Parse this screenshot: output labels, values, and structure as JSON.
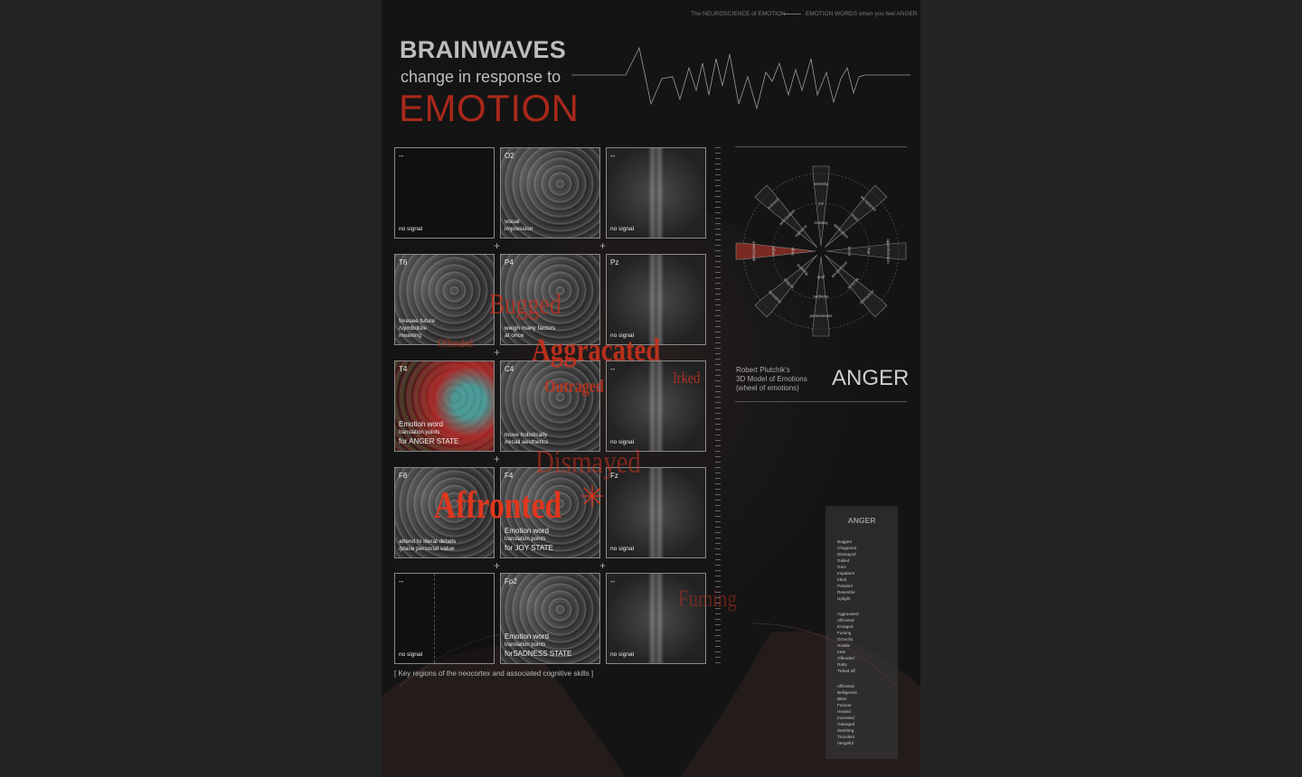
{
  "header": {
    "left": "The NEUROSCIENCE of EMOTION",
    "right": "EMOTION WORDS when you feel ANGER"
  },
  "title": {
    "line1": "BRAINWAVES",
    "line2": "change in response to",
    "line3": "EMOTION"
  },
  "grid": {
    "cells": [
      {
        "code": "--",
        "label": "no signal"
      },
      {
        "code": "O2",
        "label": "visual\nimpression"
      },
      {
        "code": "--",
        "label": "no signal"
      },
      {
        "code": "T6",
        "label": "foresee future\n/symbolize\nmeaning"
      },
      {
        "code": "P4",
        "label": "weigh many factors\nat once"
      },
      {
        "code": "Pz",
        "label": "no signal"
      },
      {
        "code": "T4",
        "label": "Emotion word",
        "sub": "translation points",
        "state": "for ANGER STATE"
      },
      {
        "code": "C4",
        "label": "move holistically\n/recall aesthetics"
      },
      {
        "code": "--",
        "label": "no signal"
      },
      {
        "code": "F8",
        "label": "attend to literal details\n/place personal value"
      },
      {
        "code": "F4",
        "label": "Emotion word",
        "sub": "translation points",
        "state": "for JOY STATE"
      },
      {
        "code": "Fz",
        "label": "no signal"
      },
      {
        "code": "--",
        "label": "no signal"
      },
      {
        "code": "Fp2",
        "label": "Emotion word",
        "sub": "translation points",
        "state": "forSADNESS STATE"
      },
      {
        "code": "--",
        "label": "no signal"
      }
    ],
    "caption": "[ Key regions of the neocortex and associated cognitive skills ]"
  },
  "overlay_words": [
    {
      "text": "Bugged"
    },
    {
      "text": "Offended"
    },
    {
      "text": "Aggracated"
    },
    {
      "text": "Outraged"
    },
    {
      "text": "Irked"
    },
    {
      "text": "Dismayed"
    },
    {
      "text": "Affronted"
    },
    {
      "text": "Fuming"
    }
  ],
  "wheel": {
    "highlight_color": "#7a2a22",
    "petals": [
      {
        "outer": "serenity",
        "mid": "joy",
        "inner": "ecstasy"
      },
      {
        "outer": "acceptance",
        "mid": "trust",
        "inner": "admiration"
      },
      {
        "outer": "apprehension",
        "mid": "fear",
        "inner": "terror"
      },
      {
        "outer": "distraction",
        "mid": "surprise",
        "inner": "amazement"
      },
      {
        "outer": "pensiveness",
        "mid": "sadness",
        "inner": "grief"
      },
      {
        "outer": "boredom",
        "mid": "disgust",
        "inner": "loathing"
      },
      {
        "outer": "annoyance",
        "mid": "anger",
        "inner": "rage"
      },
      {
        "outer": "interest",
        "mid": "anticipation",
        "inner": "vigilance"
      }
    ]
  },
  "plutchik": {
    "text": "Robert Plutchik's\n3D Model of Emotions\n(wheel of emotions)",
    "emotion": "ANGER"
  },
  "anger_panel": {
    "title": "ANGER",
    "groups": [
      [
        "Bugged",
        "Chagrined",
        "Dismayed",
        "Galled",
        "Grim",
        "Impatient",
        "Irked",
        "Petulant",
        "Resentful",
        "Uptight"
      ],
      [
        "Aggravated",
        "Affronted",
        "Enraged",
        "Fuming",
        "Grouchy",
        "Hostile",
        "Irate",
        "Offended",
        "Ratty",
        "Ticked off"
      ],
      [
        "Affronted",
        "Belligerent",
        "Bitter",
        "Furious",
        "Heated",
        "Incensed",
        "Outraged",
        "Seething",
        "Truculent",
        "Vengeful"
      ]
    ]
  },
  "colors": {
    "accent": "#a8281a",
    "background": "#141414"
  }
}
